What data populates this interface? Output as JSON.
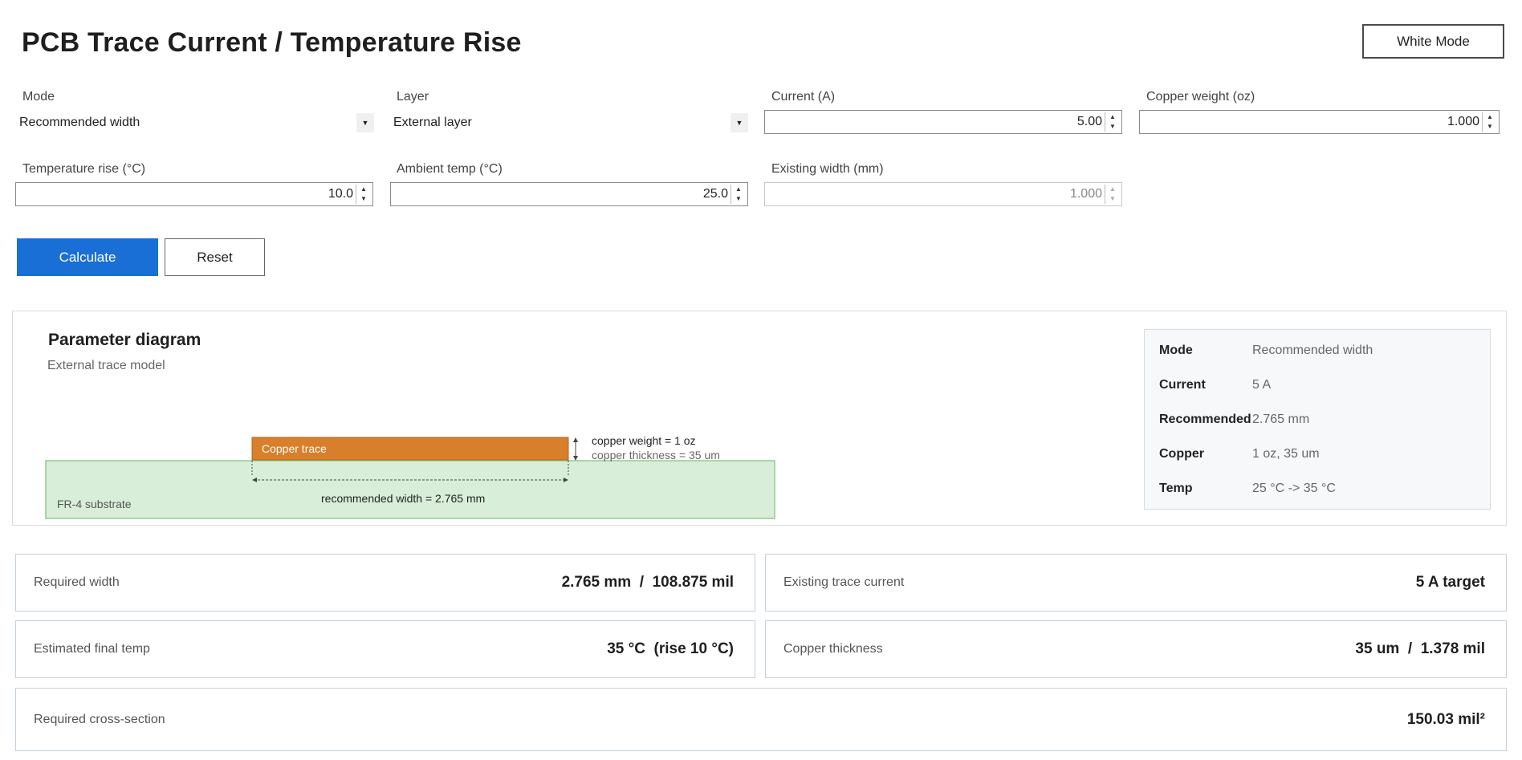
{
  "header": {
    "title": "PCB Trace Current / Temperature Rise",
    "mode_button": "White Mode"
  },
  "form": {
    "mode": {
      "label": "Mode",
      "value": "Recommended width"
    },
    "layer": {
      "label": "Layer",
      "value": "External layer"
    },
    "current": {
      "label": "Current (A)",
      "value": "5.00"
    },
    "copper_weight": {
      "label": "Copper weight (oz)",
      "value": "1.000"
    },
    "temp_rise": {
      "label": "Temperature rise (°C)",
      "value": "10.0"
    },
    "ambient": {
      "label": "Ambient temp (°C)",
      "value": "25.0"
    },
    "existing_width": {
      "label": "Existing width (mm)",
      "value": "1.000",
      "disabled": true
    }
  },
  "actions": {
    "calculate": "Calculate",
    "reset": "Reset"
  },
  "diagram": {
    "title": "Parameter diagram",
    "subtitle": "External trace model",
    "trace_label": "Copper trace",
    "weight_note": "copper weight = 1 oz",
    "thickness_note": "copper thickness = 35 um",
    "width_note": "recommended width = 2.765 mm",
    "substrate_label": "FR-4 substrate",
    "colors": {
      "trace": "#d77f2a",
      "substrate": "#d8eed8",
      "substrate_border": "#7bbf7b"
    }
  },
  "summary": [
    {
      "key": "Mode",
      "value": "Recommended width"
    },
    {
      "key": "Current",
      "value": "5 A"
    },
    {
      "key": "Recommended",
      "value": "2.765 mm"
    },
    {
      "key": "Copper",
      "value": "1 oz, 35 um"
    },
    {
      "key": "Temp",
      "value": "25 °C -> 35 °C"
    }
  ],
  "results": {
    "required_width": {
      "label": "Required width",
      "value": "2.765 mm  /  108.875 mil"
    },
    "existing_current": {
      "label": "Existing trace current",
      "value": "5 A target"
    },
    "final_temp": {
      "label": "Estimated final temp",
      "value": "35 °C  (rise 10 °C)"
    },
    "copper_thickness": {
      "label": "Copper thickness",
      "value": "35 um  /  1.378 mil"
    },
    "cross_section": {
      "label": "Required cross-section",
      "value": "150.03 mil²"
    }
  },
  "colors": {
    "accent": "#1a6fd6"
  }
}
